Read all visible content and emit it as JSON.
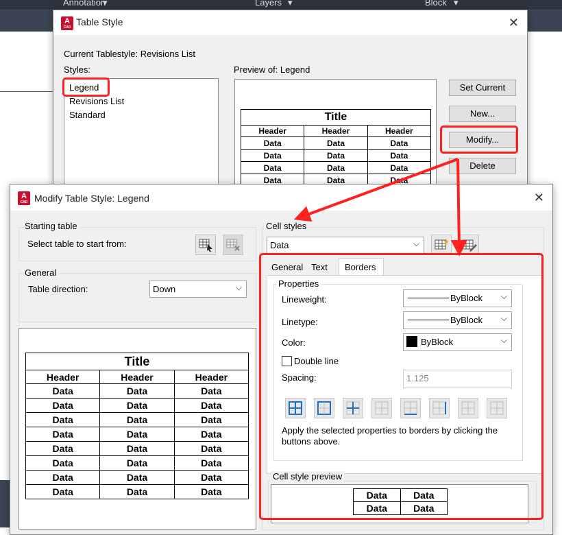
{
  "ribbon": {
    "tabs": [
      "Annotation",
      "Layers",
      "Block"
    ]
  },
  "table_style": {
    "title": "Table Style",
    "current_label": "Current Tablestyle: Revisions List",
    "styles_label": "Styles:",
    "styles": [
      "Legend",
      "Revisions List",
      "Standard"
    ],
    "preview_label": "Preview of: Legend",
    "preview": {
      "title": "Title",
      "headers": [
        "Header",
        "Header",
        "Header"
      ],
      "cell": "Data"
    },
    "buttons": {
      "set_current": "Set Current",
      "new": "New...",
      "modify": "Modify...",
      "delete": "Delete"
    }
  },
  "modify": {
    "title": "Modify Table Style: Legend",
    "starting_table": {
      "label": "Starting table",
      "select_label": "Select table to start from:"
    },
    "general": {
      "label": "General",
      "direction_label": "Table direction:",
      "direction_value": "Down"
    },
    "preview": {
      "title": "Title",
      "headers": [
        "Header",
        "Header",
        "Header"
      ],
      "cell": "Data"
    },
    "cell_styles": {
      "label": "Cell styles",
      "value": "Data",
      "tabs": [
        "General",
        "Text",
        "Borders"
      ],
      "properties_label": "Properties",
      "lineweight_label": "Lineweight:",
      "lineweight_value": "ByBlock",
      "linetype_label": "Linetype:",
      "linetype_value": "ByBlock",
      "color_label": "Color:",
      "color_value": "ByBlock",
      "double_line_label": "Double line",
      "spacing_label": "Spacing:",
      "spacing_value": "1.125",
      "apply_note": "Apply the selected properties to borders by clicking the buttons above.",
      "preview_label": "Cell style preview",
      "preview_cell": "Data"
    }
  },
  "colors": {
    "highlight": "#ff2020",
    "swatch": "#000000"
  }
}
